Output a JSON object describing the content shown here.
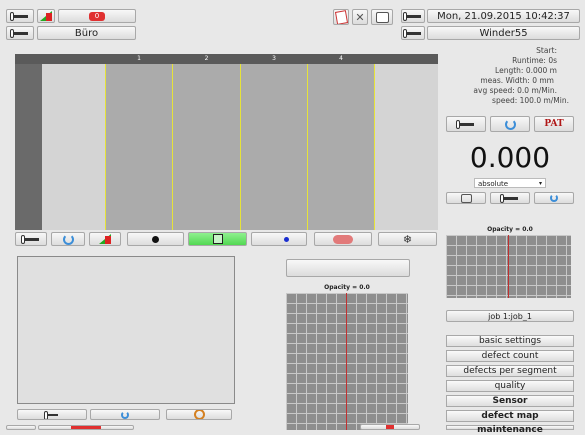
{
  "header": {
    "location": "Büro",
    "datetime": "Mon, 21.09.2015 10:42:37",
    "machine": "Winder55",
    "badge_count": "0"
  },
  "info": {
    "start": "Start:",
    "runtime": "Runtime: 0s",
    "length": "Length: 0.000 m",
    "width": "meas. Width: 0 mm",
    "avg_speed": "avg speed: 0.0 m/Min.",
    "speed": "speed: 100.0 m/Min."
  },
  "lanes": [
    "1",
    "2",
    "3",
    "4"
  ],
  "counter": {
    "value": "0.000",
    "mode": "absolute"
  },
  "brand": "PAT",
  "heatmap_right": {
    "label": "Opacity = 0.0"
  },
  "heatmap_center": {
    "label": "Opacity = 0.0"
  },
  "job": "job 1:job_1",
  "menu": {
    "items": [
      "basic settings",
      "defect count",
      "defects per segment",
      "quality",
      "Sensor",
      "defect map",
      "maintenance"
    ]
  },
  "colors": {
    "accent_green": "#5edc5e",
    "lane_line": "#e6e33a",
    "red_line": "#c03030"
  },
  "icons": {
    "wrench": "wrench-icon",
    "refresh": "refresh-icon",
    "ramp": "ramp-icon",
    "dot": "dot-icon",
    "play": "play-icon",
    "snowflake": "snowflake-icon",
    "eraser": "eraser-icon",
    "settings": "gear-icon"
  }
}
